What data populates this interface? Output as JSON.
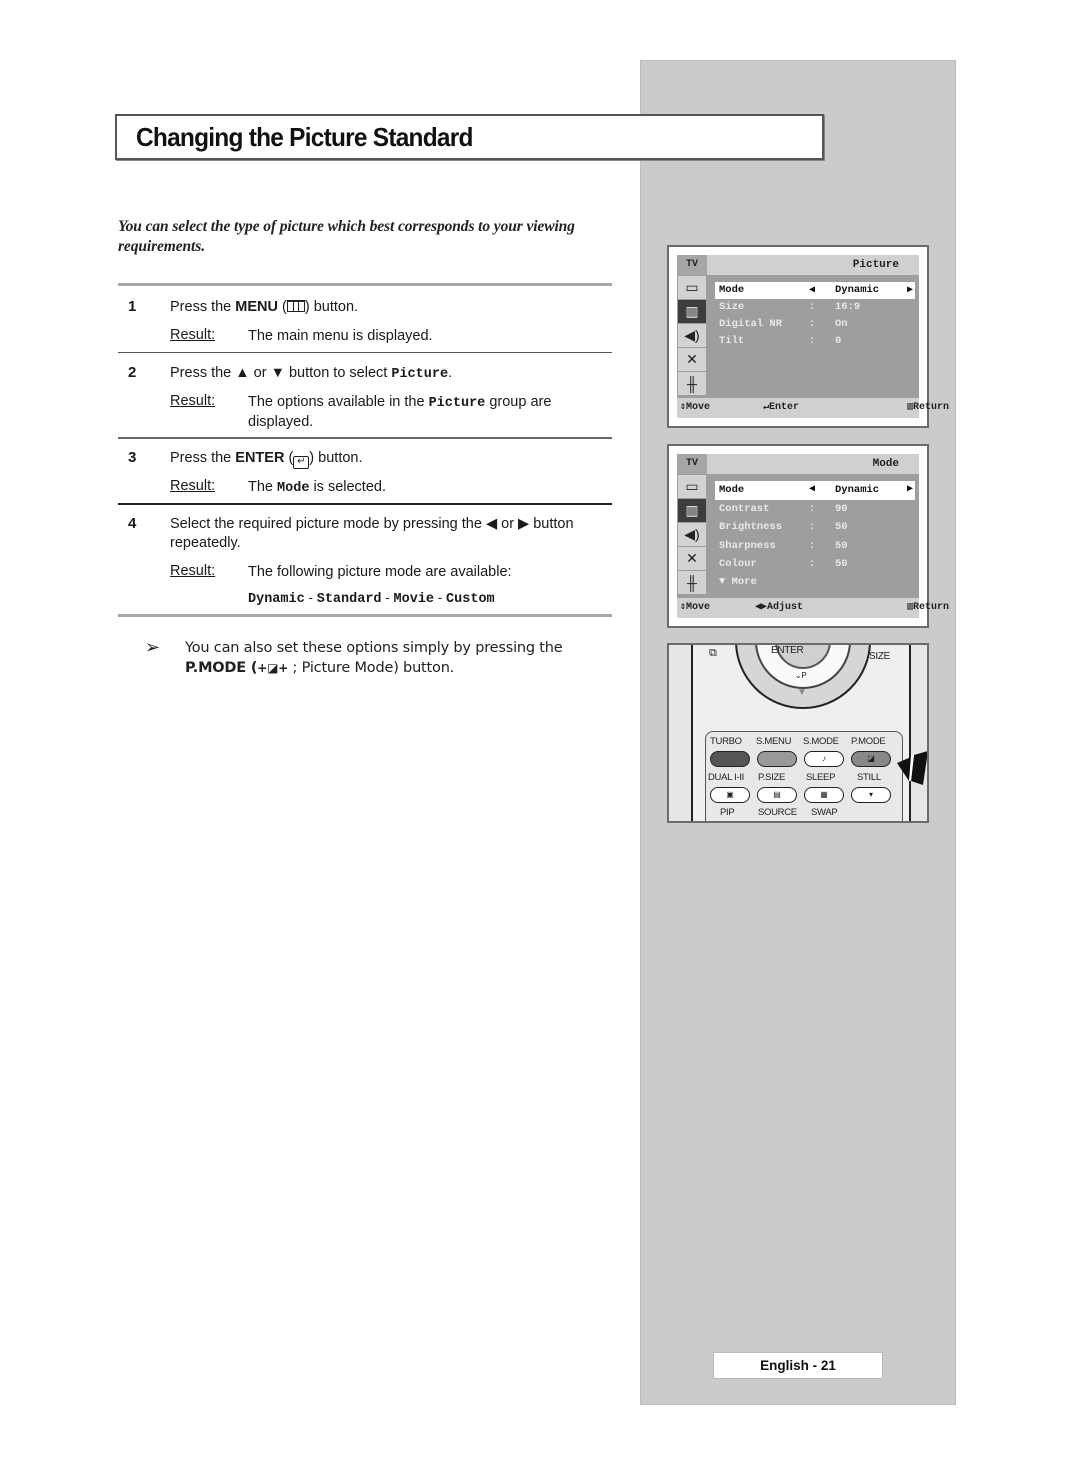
{
  "page": {
    "title": "Changing the Picture Standard",
    "intro": "You can select the type of picture which best corresponds to your viewing requirements.",
    "footer": "English - 21"
  },
  "steps": [
    {
      "number": "1",
      "instruction_pre": "Press the ",
      "instruction_bold": "MENU",
      "instruction_icon": "menu-icon",
      "instruction_post": " button.",
      "result_label": "Result:",
      "result": "The main menu is displayed."
    },
    {
      "number": "2",
      "instruction_pre": "Press the ▲ or ▼ button to select ",
      "instruction_mono": "Picture",
      "instruction_post": ".",
      "result_label": "Result:",
      "result_pre": "The options available in the ",
      "result_mono": "Picture",
      "result_post": " group are displayed."
    },
    {
      "number": "3",
      "instruction_pre": "Press the ",
      "instruction_bold": "ENTER",
      "instruction_icon": "enter-icon",
      "instruction_post": " button.",
      "result_label": "Result:",
      "result_pre": "The ",
      "result_mono": "Mode",
      "result_post": " is selected."
    },
    {
      "number": "4",
      "instruction": "Select the required picture mode by pressing the ◀ or ▶ button repeatedly.",
      "result_label": "Result:",
      "result": "The following picture mode are available:",
      "modes": [
        "Dynamic",
        "Standard",
        "Movie",
        "Custom"
      ],
      "modes_separator": " - "
    }
  ],
  "note": {
    "arrow": "➢",
    "text_pre": "You can also set these options simply by pressing the ",
    "bold": "P.MODE (",
    "icon": "picture-mode-icon",
    "text_post": " ; Picture Mode) button."
  },
  "osd_picture": {
    "source": "TV",
    "title": "Picture",
    "rows": [
      {
        "label": "Mode",
        "value": "Dynamic",
        "selected": true
      },
      {
        "label": "Size",
        "sep": ":",
        "value": "16:9"
      },
      {
        "label": "Digital NR",
        "sep": ":",
        "value": "On"
      },
      {
        "label": "Tilt",
        "sep": ":",
        "value": "0"
      }
    ],
    "footer": {
      "move": "Move",
      "enter": "Enter",
      "return": "Return"
    }
  },
  "osd_mode": {
    "source": "TV",
    "title": "Mode",
    "rows": [
      {
        "label": "Mode",
        "value": "Dynamic",
        "selected": true
      },
      {
        "label": "Contrast",
        "sep": ":",
        "value": "90"
      },
      {
        "label": "Brightness",
        "sep": ":",
        "value": "50"
      },
      {
        "label": "Sharpness",
        "sep": ":",
        "value": "50"
      },
      {
        "label": "Colour",
        "sep": ":",
        "value": "50"
      }
    ],
    "more": "More",
    "footer": {
      "move": "Move",
      "adjust": "Adjust",
      "return": "Return"
    }
  },
  "osd_icons": [
    "input-icon",
    "picture-icon",
    "sound-icon",
    "channel-icon",
    "setup-icon"
  ],
  "remote": {
    "enter": "ENTER",
    "size": "SIZE",
    "p_label": "P",
    "row1_labels": [
      "TURBO",
      "S.MENU",
      "S.MODE",
      "P.MODE"
    ],
    "row2_labels": [
      "DUAL I-II",
      "P.SIZE",
      "SLEEP",
      "STILL"
    ],
    "row3_labels": [
      "PIP",
      "SOURCE",
      "SWAP"
    ]
  }
}
